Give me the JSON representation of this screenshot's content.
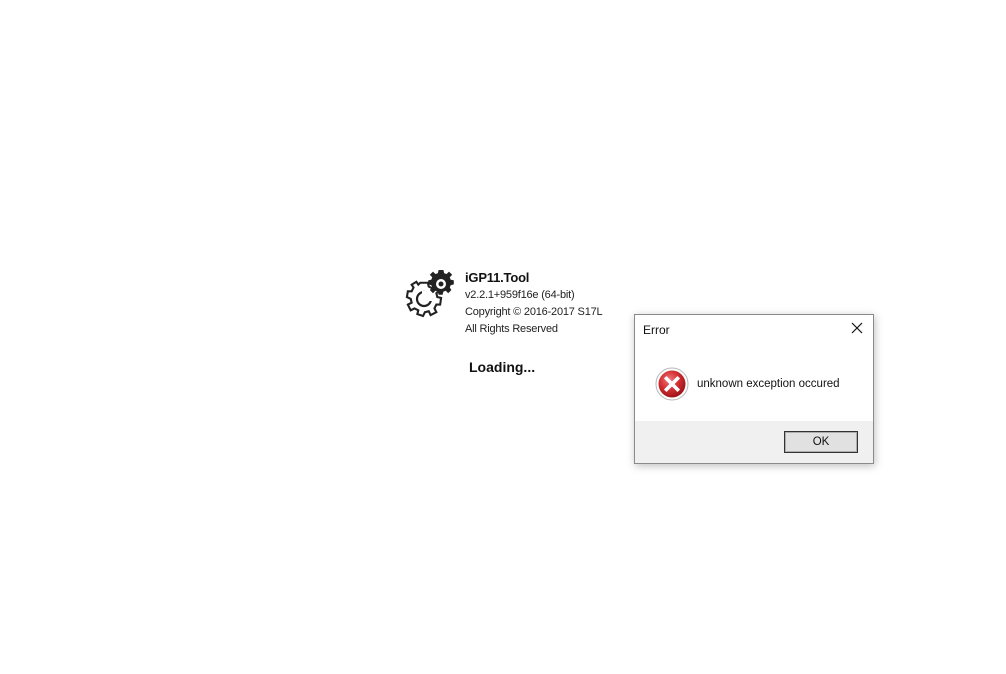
{
  "splash": {
    "logo_icon": "gears-icon",
    "app_name": "iGP11.Tool",
    "version": "v2.2.1+959f16e (64-bit)",
    "copyright": "Copyright © 2016-2017 S17L",
    "rights": "All Rights Reserved",
    "status": "Loading..."
  },
  "dialog": {
    "title": "Error",
    "close_icon": "close-icon",
    "error_icon": "error-icon",
    "message": "unknown exception occured",
    "ok_label": "OK",
    "colors": {
      "error_red": "#c8262b",
      "footer_bg": "#f0f0f0",
      "button_bg": "#e1e1e1"
    }
  }
}
